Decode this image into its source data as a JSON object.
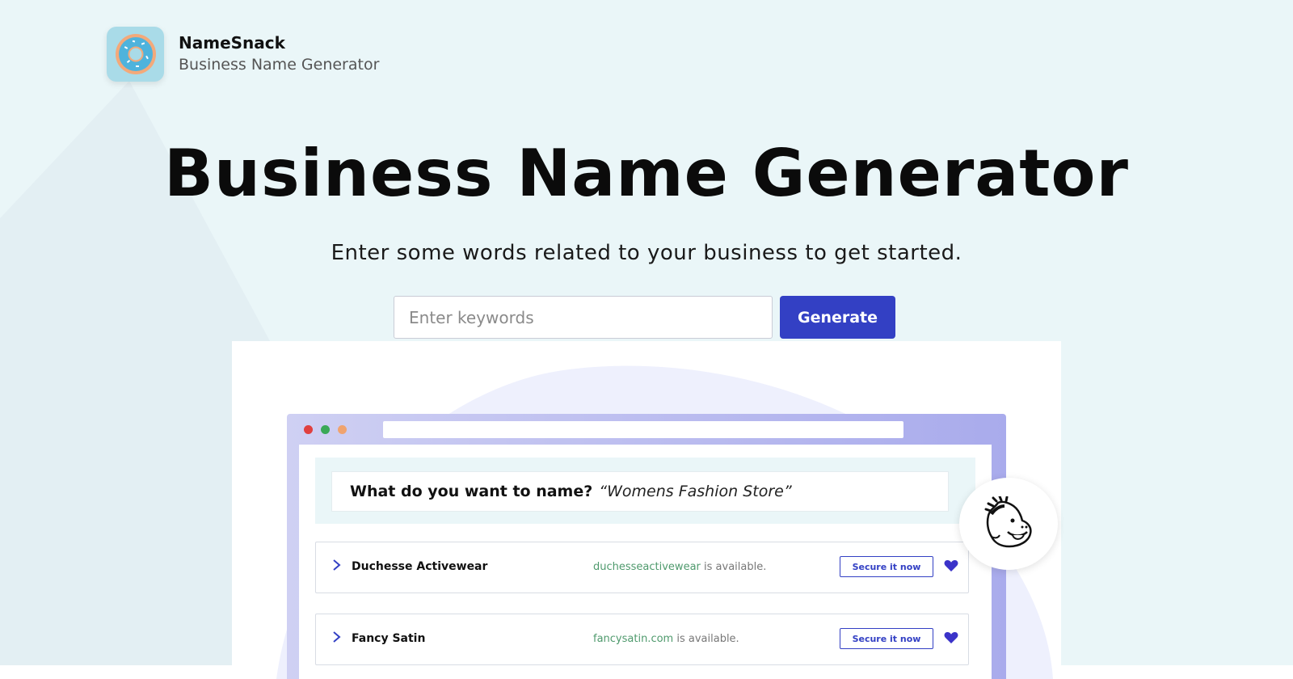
{
  "brand": {
    "name": "NameSnack",
    "subtitle": "Business Name Generator",
    "logo_icon": "donut-icon"
  },
  "hero": {
    "title": "Business Name Generator",
    "subtitle": "Enter some words related to your business to get started."
  },
  "search": {
    "placeholder": "Enter keywords",
    "value": "",
    "button_label": "Generate"
  },
  "illustration": {
    "question_label": "What do you want to name?",
    "question_value": "“Womens Fashion Store”",
    "results": [
      {
        "name": "Duchesse Activewear",
        "domain": "duchesseactivewear",
        "status": "is available.",
        "action": "Secure it now"
      },
      {
        "name": "Fancy Satin",
        "domain": "fancysatin.com",
        "status": "is available.",
        "action": "Secure it now"
      }
    ],
    "mascot_icon": "mailchimp-freddie-icon"
  },
  "colors": {
    "background": "#eaf6f8",
    "accent": "#3340c4",
    "domain_green": "#4f9a6d",
    "heart": "#3b33c9"
  }
}
